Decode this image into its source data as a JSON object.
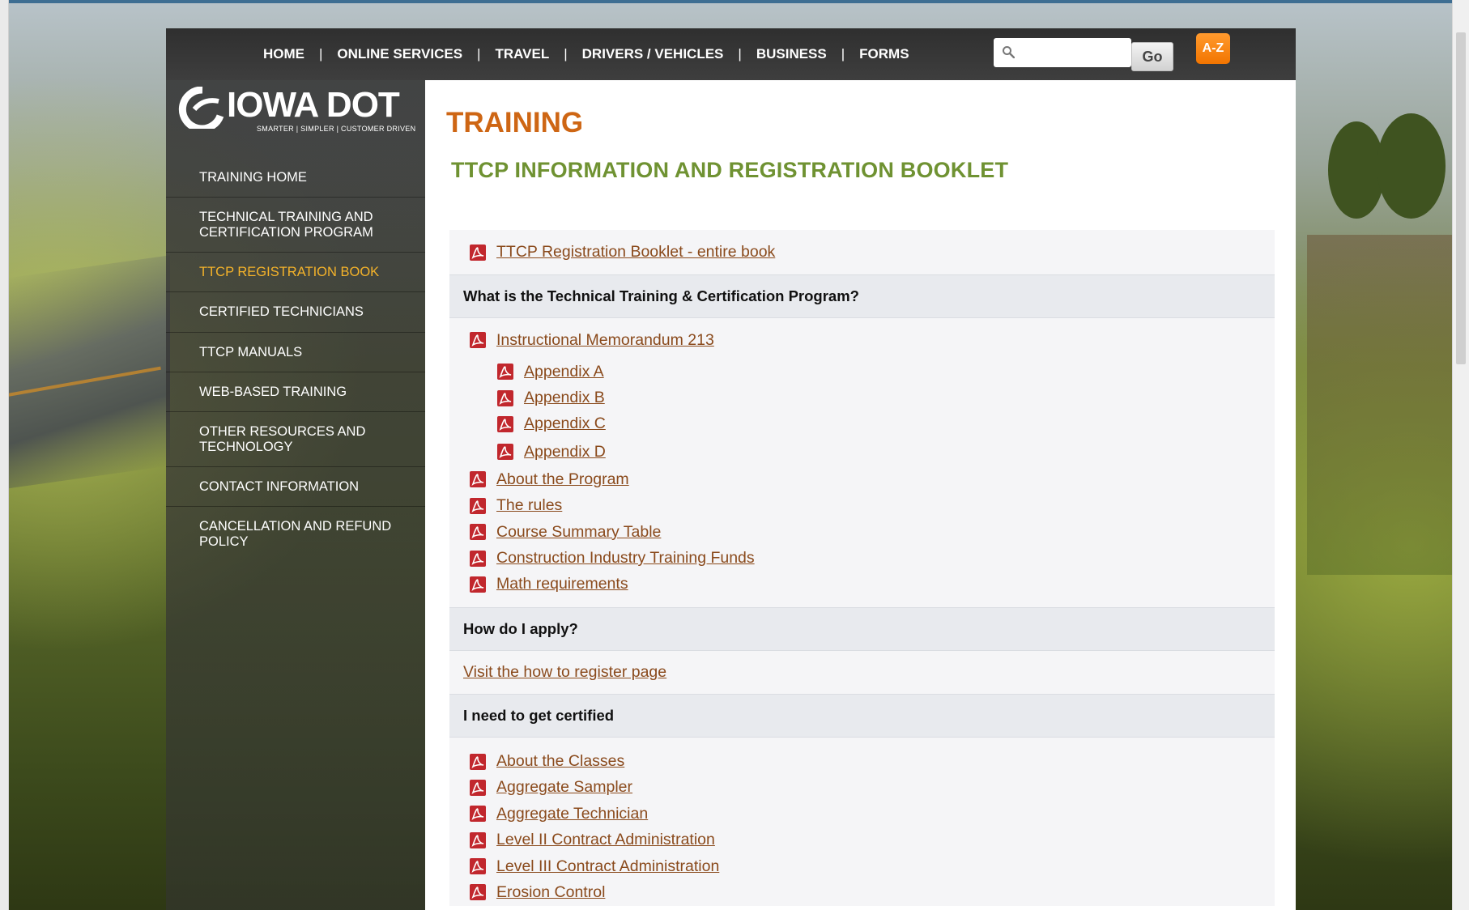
{
  "nav": {
    "items": [
      "HOME",
      "ONLINE SERVICES",
      "TRAVEL",
      "DRIVERS / VEHICLES",
      "BUSINESS",
      "FORMS"
    ],
    "separator": "|",
    "search_value": "",
    "go_label": "Go",
    "az_label": "A-Z"
  },
  "logo": {
    "text": "IOWA DOT",
    "tagline": "SMARTER | SIMPLER | CUSTOMER DRIVEN"
  },
  "sidebar": {
    "items": [
      "TRAINING HOME",
      "TECHNICAL TRAINING AND CERTIFICATION PROGRAM",
      "TTCP REGISTRATION BOOK",
      "CERTIFIED TECHNICIANS",
      "TTCP MANUALS",
      "WEB-BASED TRAINING",
      "OTHER RESOURCES AND TECHNOLOGY",
      "CONTACT INFORMATION",
      "CANCELLATION AND REFUND POLICY"
    ],
    "active_index": 2
  },
  "main": {
    "title": "TRAINING",
    "subtitle": "TTCP INFORMATION AND REGISTRATION BOOKLET",
    "top_link": "TTCP Registration Booklet - entire book",
    "section1": {
      "heading": "What is the Technical Training & Certification Program?",
      "memo": "Instructional Memorandum 213",
      "appendices": [
        "Appendix A",
        "Appendix B",
        "Appendix C",
        "Appendix D"
      ],
      "links": [
        "About the Program",
        "The rules",
        "Course Summary Table",
        "Construction Industry Training Funds",
        "Math requirements"
      ]
    },
    "section2": {
      "heading": "How do I apply?",
      "link": "Visit the how to register page"
    },
    "section3": {
      "heading": "I need to get certified",
      "links": [
        "About the Classes",
        "Aggregate Sampler",
        "Aggregate Technician",
        "Level II Contract Administration",
        "Level III Contract Administration",
        "Erosion Control"
      ]
    }
  },
  "colors": {
    "title": "#ce6614",
    "subtitle": "#6f9232",
    "link": "#8a4a1c",
    "active_nav": "#f5b32a",
    "az_button": "#f27500"
  }
}
